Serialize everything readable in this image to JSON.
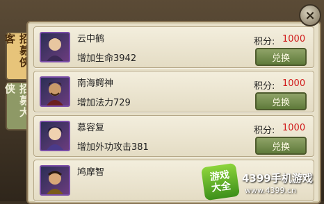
{
  "close_label": "×",
  "tabs": [
    {
      "label": "招募侠客",
      "active": true
    },
    {
      "label": "招募大侠",
      "active": false
    }
  ],
  "score_label": "积分:",
  "exchange_label": "兑换",
  "items": [
    {
      "name": "云中鹤",
      "desc": "增加生命3942",
      "score": "1000"
    },
    {
      "name": "南海鳄神",
      "desc": "增加法力729",
      "score": "1000"
    },
    {
      "name": "慕容复",
      "desc": "增加外功攻击381",
      "score": "1000"
    },
    {
      "name": "鸠摩智",
      "desc": "",
      "score": ""
    }
  ],
  "watermark": {
    "badge_line1": "游戏",
    "badge_line2": "大全",
    "brand": "4399手机游戏",
    "url": "www.4399.cn"
  },
  "colors": {
    "score_value": "#d01a1a",
    "button": "#6f8a44",
    "active_tab": "#e7c47a",
    "inactive_tab": "#8e9966"
  }
}
